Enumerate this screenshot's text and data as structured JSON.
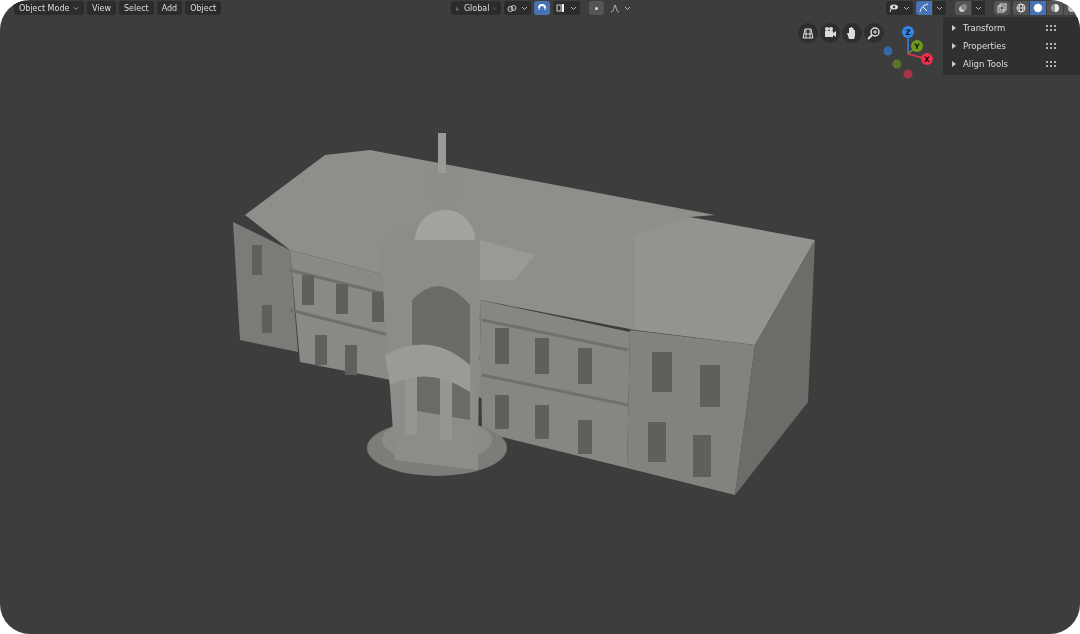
{
  "header": {
    "mode": "Object Mode",
    "menus": [
      "View",
      "Select",
      "Add",
      "Object"
    ],
    "orientation": "Global",
    "snap_on": true,
    "gizmos_on": true,
    "shading_modes": [
      {
        "kind": "wireframe",
        "selected": false
      },
      {
        "kind": "solid",
        "selected": true
      },
      {
        "kind": "material",
        "selected": false
      },
      {
        "kind": "rendered",
        "selected": false
      }
    ]
  },
  "gizmo": {
    "axes": [
      {
        "label": "Z",
        "color": "#2f86e8"
      },
      {
        "label": "Y",
        "color": "#6f9a1f"
      },
      {
        "label": "X",
        "color": "#f0304f"
      }
    ]
  },
  "sidebar": {
    "panels": [
      {
        "label": "Transform",
        "expanded": false
      },
      {
        "label": "Properties",
        "expanded": false
      },
      {
        "label": "Align Tools",
        "expanded": false
      }
    ]
  }
}
